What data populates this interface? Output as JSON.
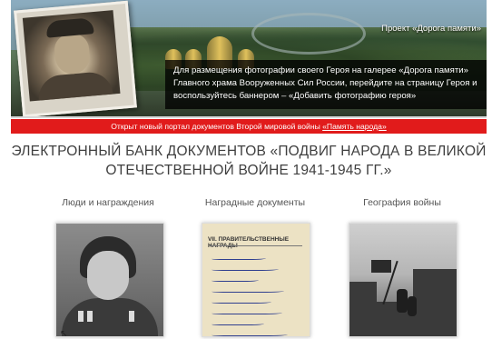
{
  "banner": {
    "project_link": "Проект «Дорога памяти»",
    "text": "Для размещения фотографии своего Героя на галерее «Дорога памяти» Главного храма Вооруженных Сил России, перейдите на страницу Героя и воспользуйтесь баннером – «Добавить фотографию героя»"
  },
  "notice": {
    "prefix": "Открыт новый портал документов Второй мировой войны ",
    "link": "«Память народа»"
  },
  "page": {
    "title": "ЭЛЕКТРОННЫЙ БАНК ДОКУМЕНТОВ «ПОДВИГ НАРОДА В ВЕЛИКОЙ ОТЕЧЕСТВЕННОЙ ВОЙНЕ 1941-1945 ГГ.»"
  },
  "sections": [
    {
      "label": "Люди и награждения"
    },
    {
      "label": "Наградные документы"
    },
    {
      "label": "География войны"
    }
  ],
  "document_thumb": {
    "header": "VII. ПРАВИТЕЛЬСТВЕННЫЕ НАГРАДЫ"
  },
  "colors": {
    "notice_bg": "#e11b1b",
    "banner_panel": "#000000",
    "title_text": "#3f3f3f"
  }
}
